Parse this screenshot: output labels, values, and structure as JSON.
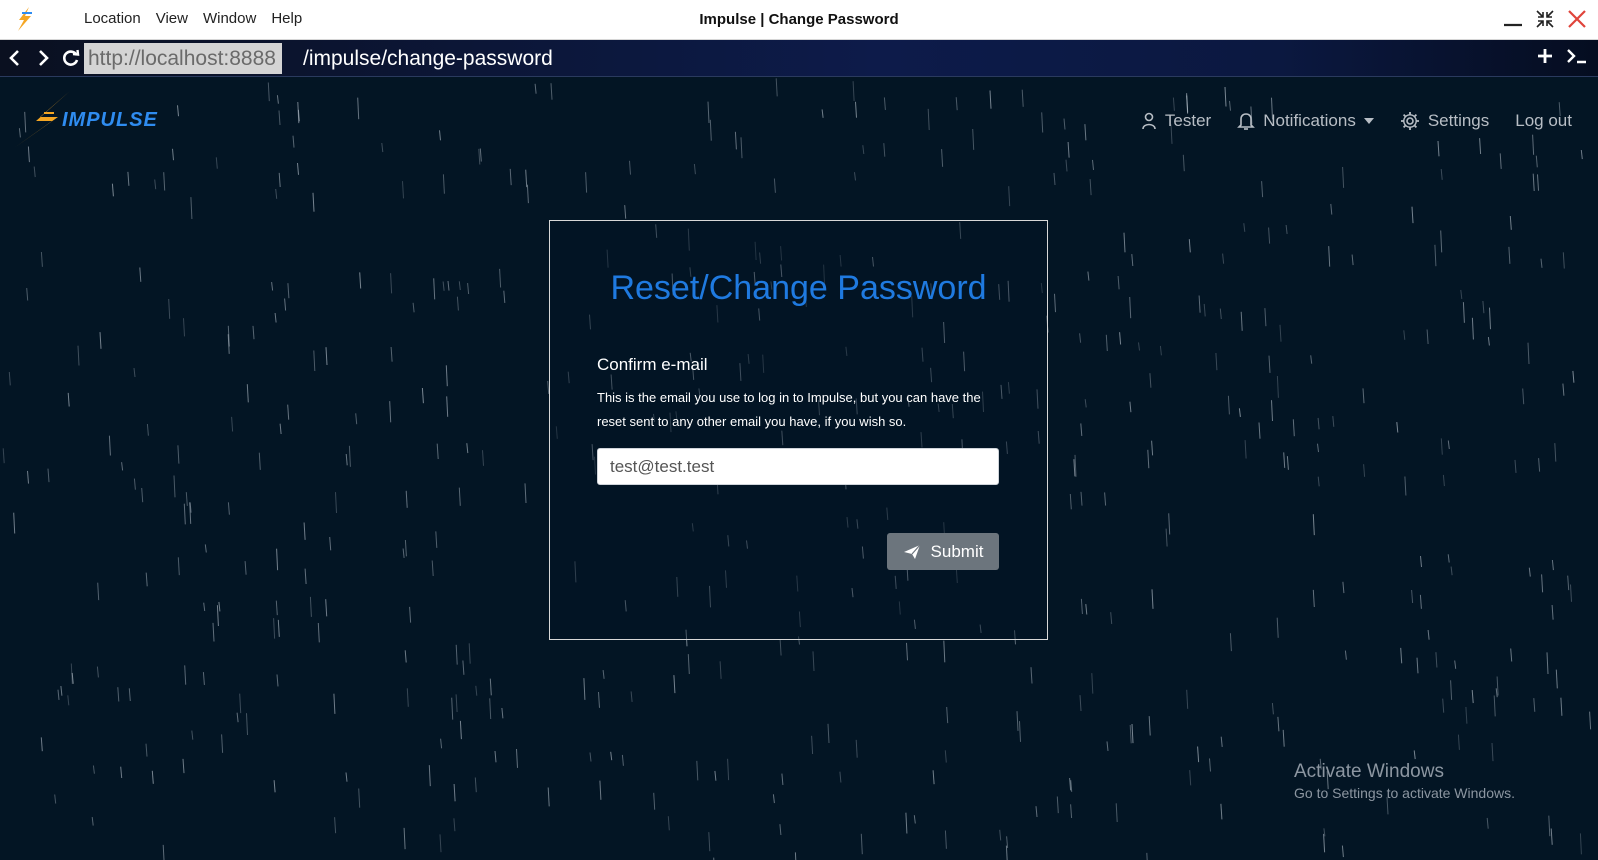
{
  "menu": {
    "items": [
      "Location",
      "View",
      "Window",
      "Help"
    ]
  },
  "window": {
    "title": "Impulse | Change Password"
  },
  "address": {
    "host": "http://localhost:8888",
    "path": "/impulse/change-password"
  },
  "brand": {
    "name": "IMPULSE"
  },
  "nav": {
    "user": "Tester",
    "notifications": "Notifications",
    "settings": "Settings",
    "logout": "Log out"
  },
  "form": {
    "title": "Reset/Change Password",
    "label": "Confirm e-mail",
    "help": "This is the email you use to log in to Impulse, but you can have the reset sent to any other email you have, if you wish so.",
    "email_value": "test@test.test",
    "submit_label": "Submit"
  },
  "watermark": {
    "title": "Activate Windows",
    "subtitle": "Go to Settings to activate Windows."
  },
  "colors": {
    "background": "#031524",
    "title_accent": "#1f7ae0",
    "submit_bg": "#6c757d",
    "brand_orange": "#f5a623",
    "brand_blue": "#2f8cf0"
  }
}
